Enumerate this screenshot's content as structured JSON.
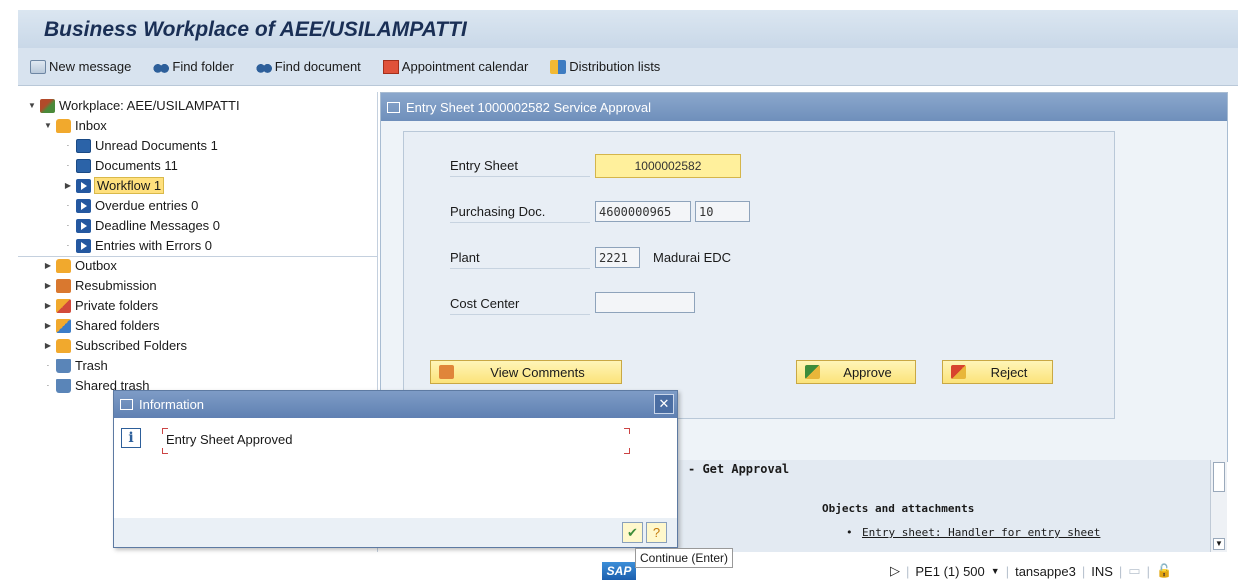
{
  "window": {
    "title": "Business Workplace of AEE/USILAMPATTI"
  },
  "toolbar": {
    "new_message": "New message",
    "find_folder": "Find folder",
    "find_document": "Find document",
    "appointment_calendar": "Appointment calendar",
    "distribution_lists": "Distribution lists"
  },
  "tree": {
    "root": "Workplace: AEE/USILAMPATTI",
    "inbox": "Inbox",
    "unread": "Unread Documents 1",
    "documents": "Documents 11",
    "workflow": "Workflow 1",
    "overdue": "Overdue entries 0",
    "deadline": "Deadline Messages 0",
    "errors": "Entries with Errors 0",
    "outbox": "Outbox",
    "resubmission": "Resubmission",
    "private_folders": "Private folders",
    "shared_folders": "Shared folders",
    "subscribed_folders": "Subscribed Folders",
    "trash": "Trash",
    "shared_trash": "Shared trash"
  },
  "entry": {
    "header": "Entry Sheet 1000002582 Service Approval",
    "entry_sheet_label": "Entry Sheet",
    "entry_sheet_value": "1000002582",
    "purchasing_label": "Purchasing Doc.",
    "purchasing_value": "4600000965",
    "purchasing_item": "10",
    "plant_label": "Plant",
    "plant_value": "2221",
    "plant_name": "Madurai EDC",
    "cost_center_label": "Cost Center",
    "cost_center_value": "",
    "view_comments": "View Comments",
    "approve": "Approve",
    "reject": "Reject"
  },
  "preview": {
    "heading": "- Get Approval",
    "objects_heading": "Objects and attachments",
    "attachment_link": "Entry sheet: Handler for entry sheet"
  },
  "dialog": {
    "title": "Information",
    "message": "Entry Sheet Approved",
    "close_glyph": "✕",
    "ok_glyph": "✔",
    "help_glyph": "?"
  },
  "tooltip": {
    "text": "Continue  (Enter)"
  },
  "status": {
    "logo": "SAP",
    "system": "PE1 (1) 500",
    "server": "tansappe3",
    "mode": "INS"
  }
}
